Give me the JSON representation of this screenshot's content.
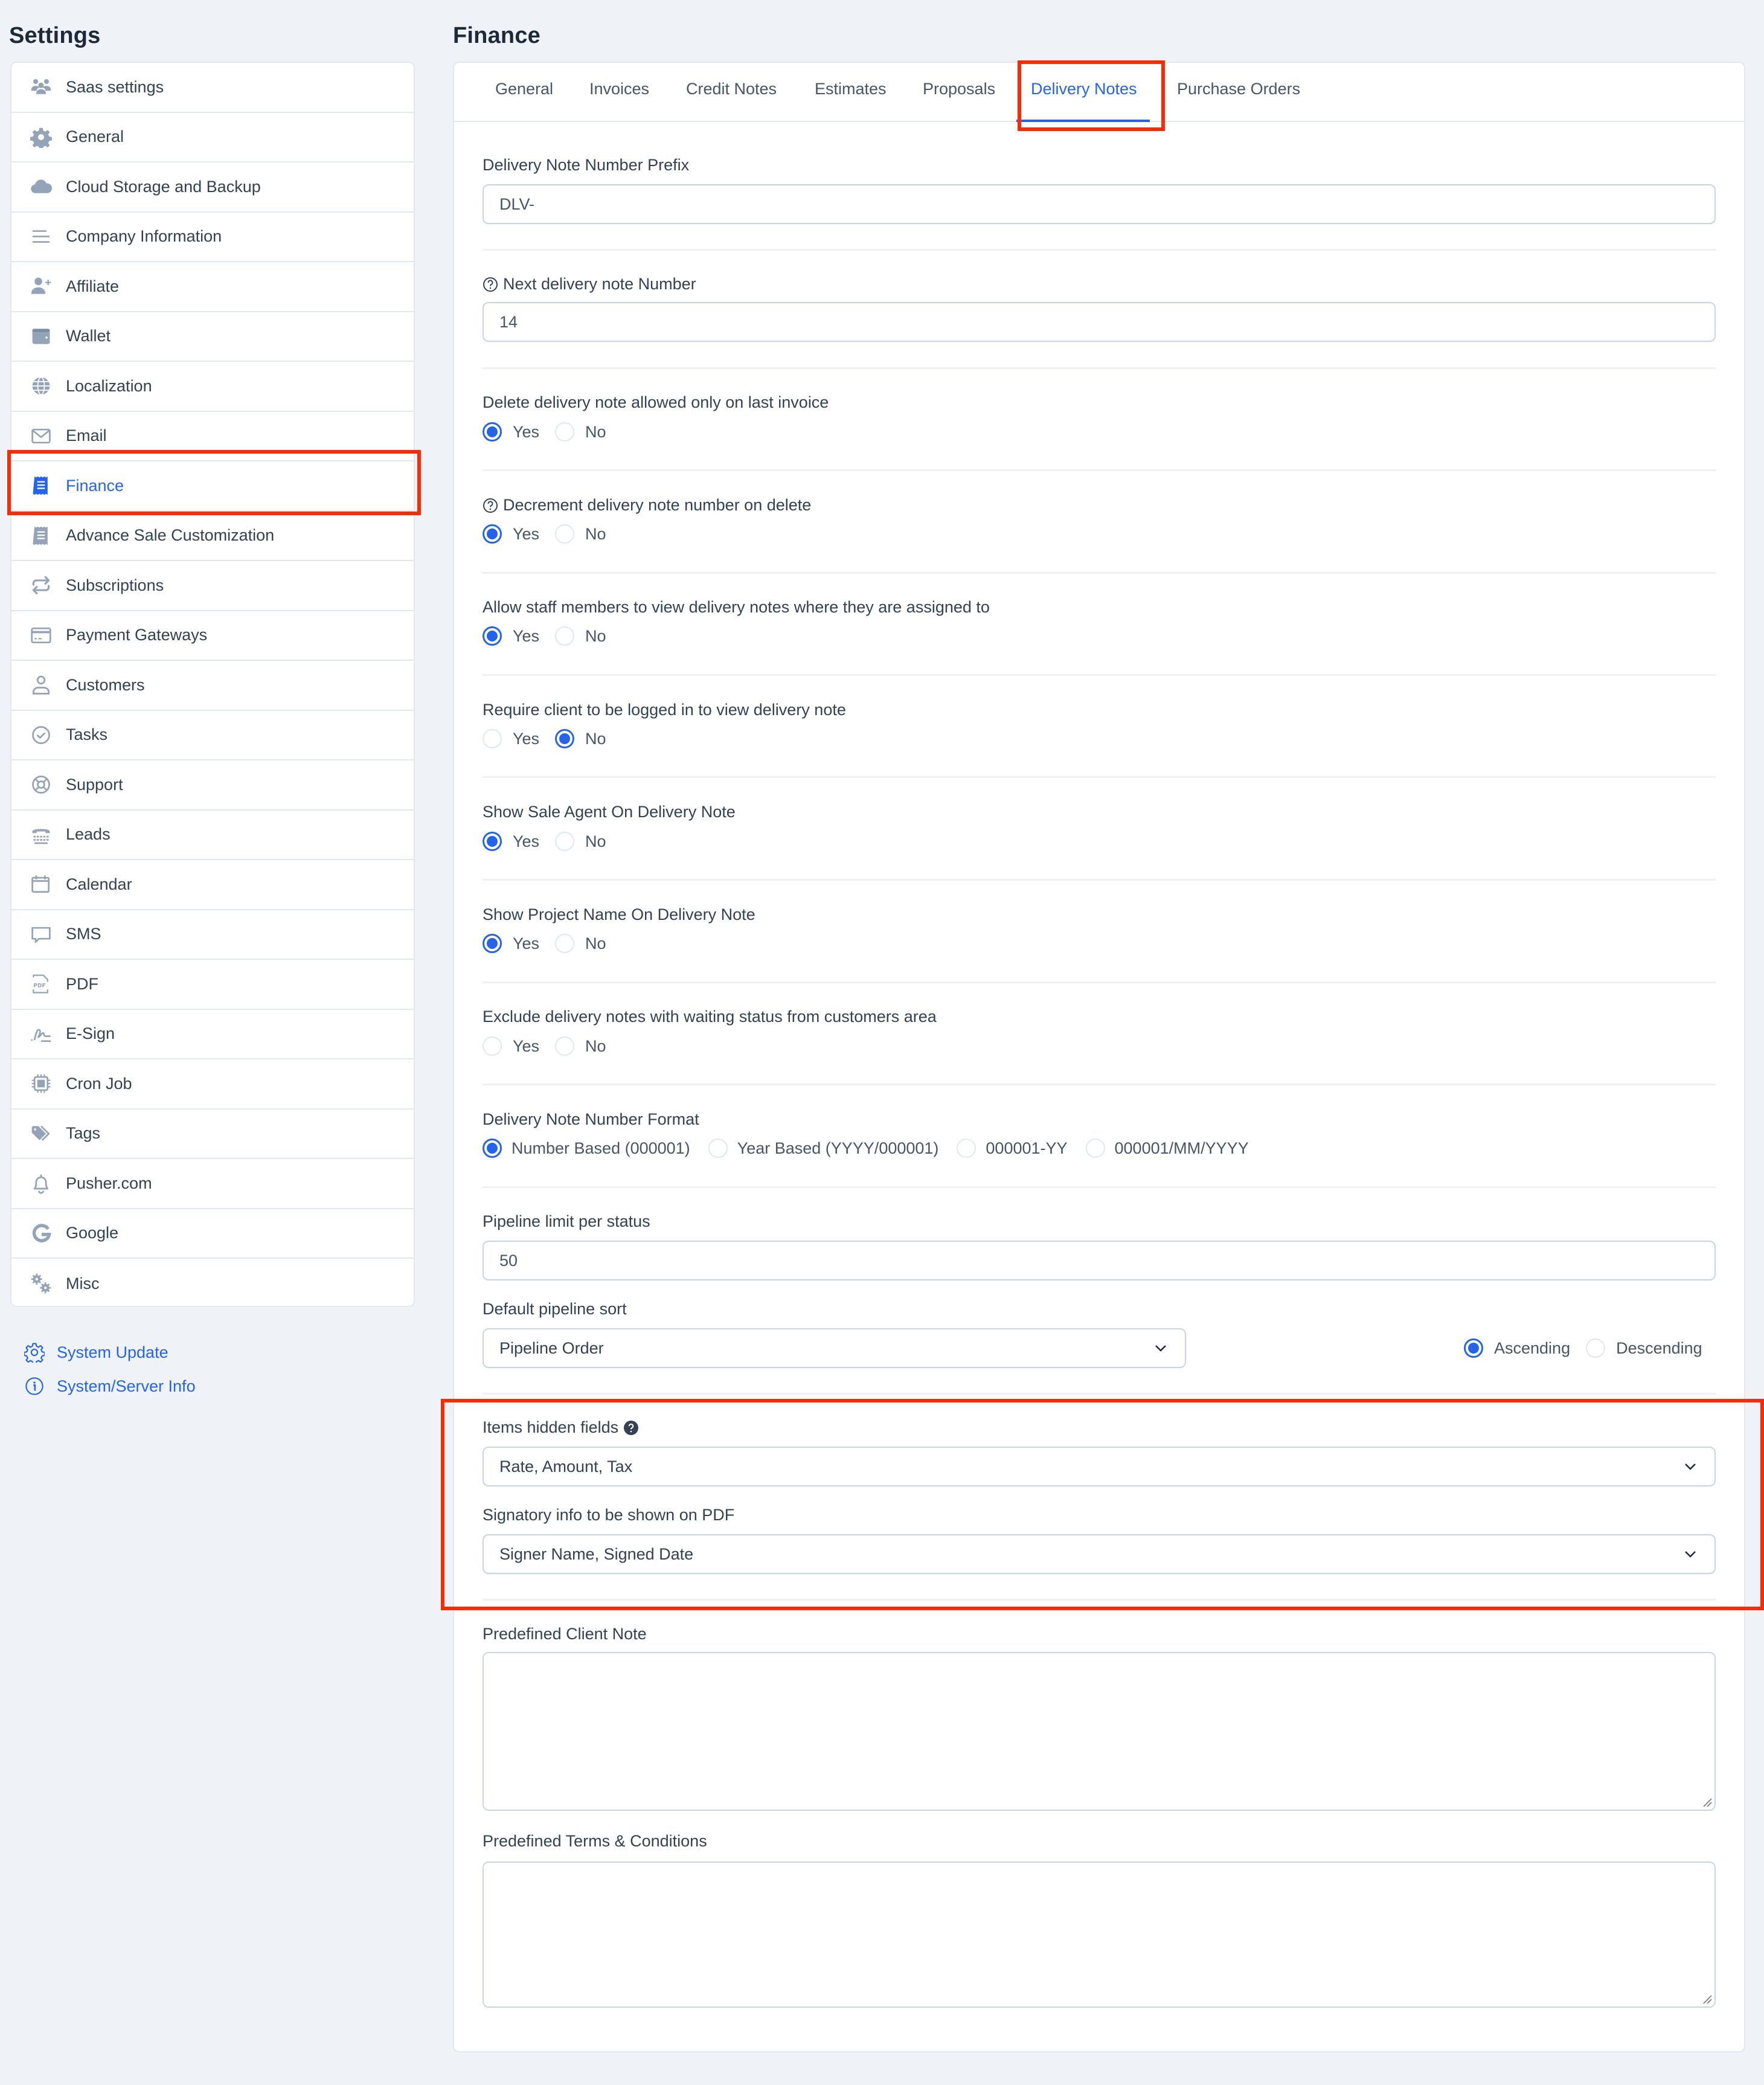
{
  "sidebar": {
    "title": "Settings",
    "items": [
      {
        "label": "Saas settings",
        "icon": "users-icon"
      },
      {
        "label": "General",
        "icon": "gear-icon"
      },
      {
        "label": "Cloud Storage and Backup",
        "icon": "cloud-icon"
      },
      {
        "label": "Company Information",
        "icon": "menu-lines-icon"
      },
      {
        "label": "Affiliate",
        "icon": "user-plus-icon"
      },
      {
        "label": "Wallet",
        "icon": "wallet-icon"
      },
      {
        "label": "Localization",
        "icon": "globe-icon"
      },
      {
        "label": "Email",
        "icon": "envelope-icon"
      },
      {
        "label": "Finance",
        "icon": "receipt-icon",
        "active": true
      },
      {
        "label": "Advance Sale Customization",
        "icon": "receipt-icon"
      },
      {
        "label": "Subscriptions",
        "icon": "repeat-icon"
      },
      {
        "label": "Payment Gateways",
        "icon": "credit-card-icon"
      },
      {
        "label": "Customers",
        "icon": "user-icon"
      },
      {
        "label": "Tasks",
        "icon": "check-circle-icon"
      },
      {
        "label": "Support",
        "icon": "lifebuoy-icon"
      },
      {
        "label": "Leads",
        "icon": "phone-icon"
      },
      {
        "label": "Calendar",
        "icon": "calendar-icon"
      },
      {
        "label": "SMS",
        "icon": "chat-bubble-icon"
      },
      {
        "label": "PDF",
        "icon": "pdf-file-icon"
      },
      {
        "label": "E-Sign",
        "icon": "signature-icon"
      },
      {
        "label": "Cron Job",
        "icon": "chip-icon"
      },
      {
        "label": "Tags",
        "icon": "tags-icon"
      },
      {
        "label": "Pusher.com",
        "icon": "bell-icon"
      },
      {
        "label": "Google",
        "icon": "google-icon"
      },
      {
        "label": "Misc",
        "icon": "gears-icon"
      }
    ],
    "links": [
      {
        "label": "System Update",
        "icon": "cog-outline-icon"
      },
      {
        "label": "System/Server Info",
        "icon": "info-circle-icon"
      }
    ]
  },
  "main": {
    "title": "Finance",
    "tabs": [
      {
        "label": "General"
      },
      {
        "label": "Invoices"
      },
      {
        "label": "Credit Notes"
      },
      {
        "label": "Estimates"
      },
      {
        "label": "Proposals"
      },
      {
        "label": "Delivery Notes",
        "active": true
      },
      {
        "label": "Purchase Orders"
      }
    ],
    "fields": {
      "prefix": {
        "label": "Delivery Note Number Prefix",
        "value": "DLV-"
      },
      "next_number": {
        "label": "Next delivery note Number",
        "value": "14"
      },
      "delete_last": {
        "label": "Delete delivery note allowed only on last invoice",
        "options": [
          "Yes",
          "No"
        ],
        "selected": "Yes"
      },
      "decrement": {
        "label": "Decrement delivery note number on delete",
        "options": [
          "Yes",
          "No"
        ],
        "selected": "Yes"
      },
      "staff_view": {
        "label": "Allow staff members to view delivery notes where they are assigned to",
        "options": [
          "Yes",
          "No"
        ],
        "selected": "Yes"
      },
      "require_login": {
        "label": "Require client to be logged in to view delivery note",
        "options": [
          "Yes",
          "No"
        ],
        "selected": "No"
      },
      "show_sale_agent": {
        "label": "Show Sale Agent On Delivery Note",
        "options": [
          "Yes",
          "No"
        ],
        "selected": "Yes"
      },
      "show_project": {
        "label": "Show Project Name On Delivery Note",
        "options": [
          "Yes",
          "No"
        ],
        "selected": "Yes"
      },
      "exclude_waiting": {
        "label": "Exclude delivery notes with waiting status from customers area",
        "options": [
          "Yes",
          "No"
        ],
        "selected": null
      },
      "number_format": {
        "label": "Delivery Note Number Format",
        "options": [
          "Number Based (000001)",
          "Year Based (YYYY/000001)",
          "000001-YY",
          "000001/MM/YYYY"
        ],
        "selected": "Number Based (000001)"
      },
      "pipeline_limit": {
        "label": "Pipeline limit per status",
        "value": "50"
      },
      "pipeline_sort": {
        "label": "Default pipeline sort",
        "value": "Pipeline Order",
        "order_options": [
          "Ascending",
          "Descending"
        ],
        "order_selected": "Ascending"
      },
      "items_hidden": {
        "label": "Items hidden fields",
        "value": "Rate, Amount, Tax"
      },
      "signatory": {
        "label": "Signatory info to be shown on PDF",
        "value": "Signer Name, Signed Date"
      },
      "client_note": {
        "label": "Predefined Client Note",
        "value": ""
      },
      "terms": {
        "label": "Predefined Terms & Conditions",
        "value": ""
      }
    }
  },
  "colors": {
    "accent": "#2563eb",
    "highlight": "#ff2a00",
    "background": "#eff3f8",
    "text": "#334155",
    "icon": "#94a3b8"
  }
}
